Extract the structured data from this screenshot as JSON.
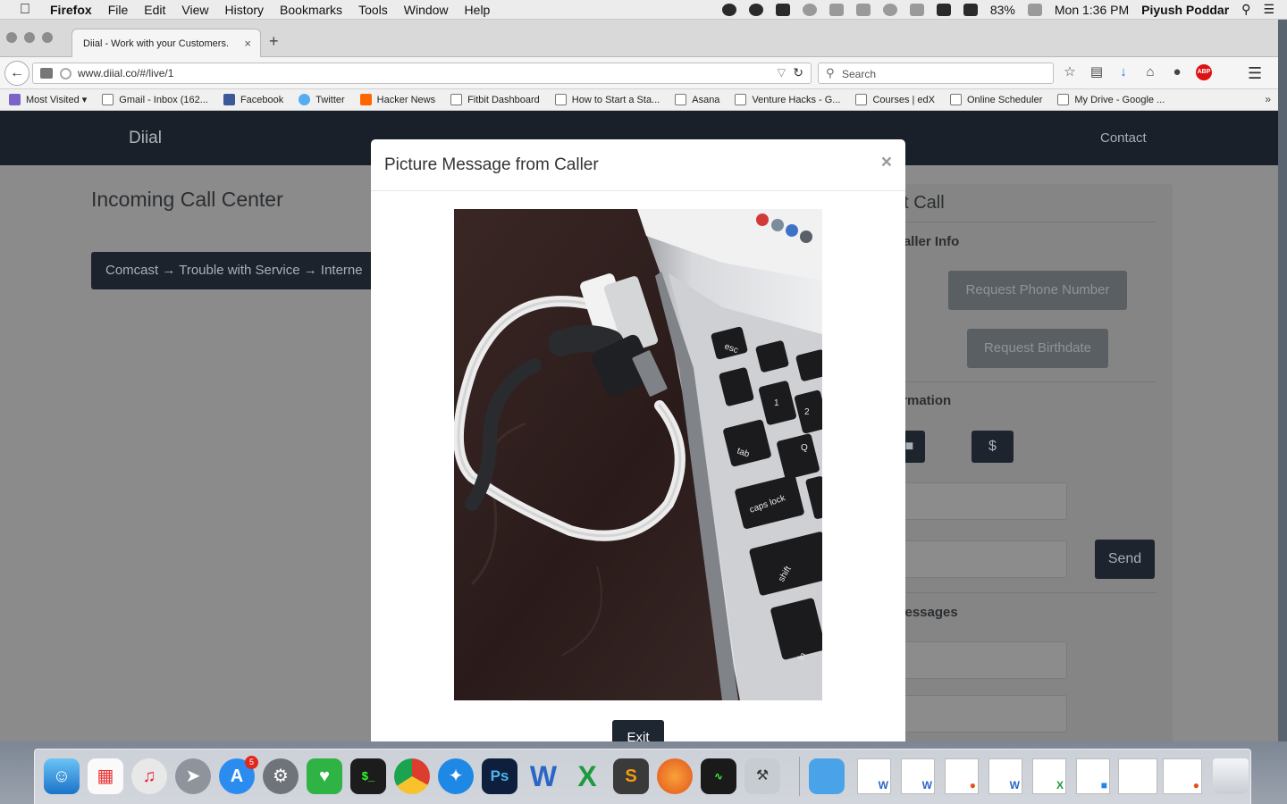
{
  "menubar": {
    "app_name": "Firefox",
    "menus": [
      "File",
      "Edit",
      "View",
      "History",
      "Bookmarks",
      "Tools",
      "Window",
      "Help"
    ],
    "battery": "83%",
    "clock": "Mon 1:36 PM",
    "user": "Piyush Poddar"
  },
  "browser": {
    "tab_title": "Diial - Work with your Customers.",
    "url": "www.diial.co/#/live/1",
    "search_placeholder": "Search",
    "bookmarks": [
      {
        "label": "Most Visited",
        "icon": "most-visited-icon"
      },
      {
        "label": "Gmail - Inbox (162...",
        "icon": "page-icon"
      },
      {
        "label": "Facebook",
        "icon": "facebook-icon"
      },
      {
        "label": "Twitter",
        "icon": "twitter-icon"
      },
      {
        "label": "Hacker News",
        "icon": "hackernews-icon"
      },
      {
        "label": "Fitbit Dashboard",
        "icon": "page-icon"
      },
      {
        "label": "How to Start a Sta...",
        "icon": "page-icon"
      },
      {
        "label": "Asana",
        "icon": "page-icon"
      },
      {
        "label": "Venture Hacks - G...",
        "icon": "page-icon"
      },
      {
        "label": "Courses | edX",
        "icon": "page-icon"
      },
      {
        "label": "Online Scheduler",
        "icon": "page-icon"
      },
      {
        "label": "My Drive - Google ...",
        "icon": "page-icon"
      }
    ]
  },
  "site": {
    "brand": "Diial",
    "nav_contact": "Contact",
    "left_title": "Incoming Call Center",
    "call_path": "Comcast → Trouble with Service → Interne",
    "panel": {
      "title": "nt Call",
      "caller_info": "Caller Info",
      "request_phone": "Request Phone Number",
      "request_birthdate": "Request Birthdate",
      "information": "ormation",
      "dollar_button": "$",
      "send_button": "Send",
      "messages": "Messages"
    }
  },
  "modal": {
    "title": "Picture Message from Caller",
    "close": "×",
    "exit_button": "Exit",
    "photo_keys": [
      "esc",
      "tab",
      "caps lock",
      "shift",
      "fn",
      "Q",
      "1",
      "2"
    ]
  },
  "dock": {
    "appstore_badge": "5"
  },
  "colors": {
    "navbar": "#1a2029",
    "button_dark": "#1d2631",
    "overlay_dim": "#8b8b8b"
  }
}
